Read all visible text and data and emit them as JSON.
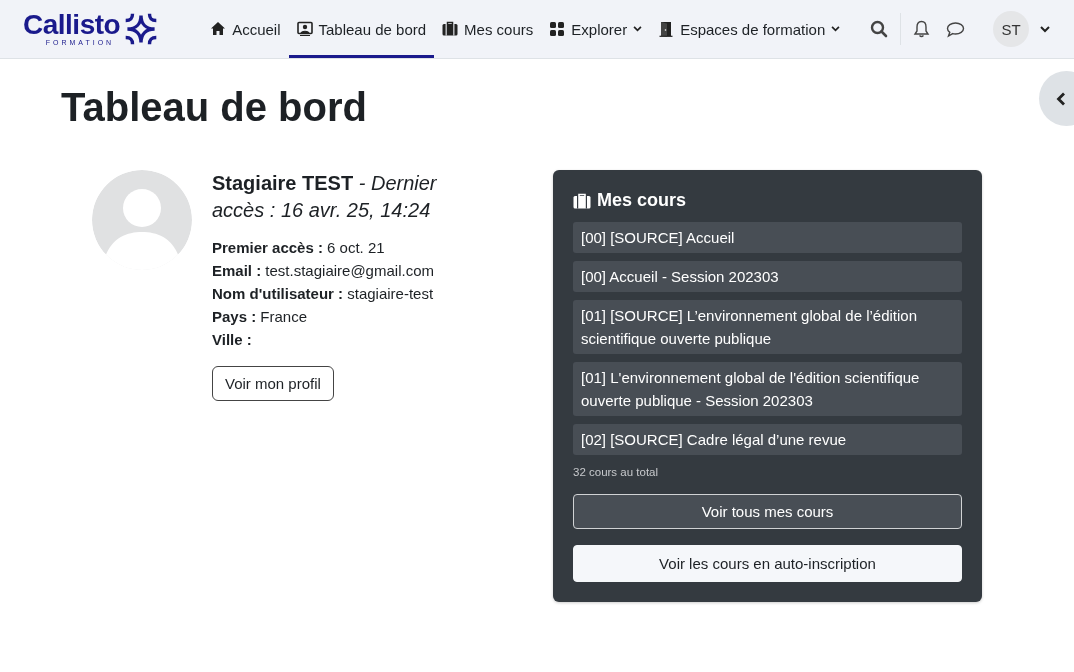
{
  "logo": {
    "name": "Callisto",
    "tagline": "FORMATION"
  },
  "nav": [
    {
      "label": "Accueil",
      "kind": "home",
      "selected": false,
      "dropdown": false
    },
    {
      "label": "Tableau de bord",
      "kind": "dashboard",
      "selected": true,
      "dropdown": false
    },
    {
      "label": "Mes cours",
      "kind": "briefcase",
      "selected": false,
      "dropdown": false
    },
    {
      "label": "Explorer",
      "kind": "grid",
      "selected": false,
      "dropdown": true
    },
    {
      "label": "Espaces de formation",
      "kind": "door",
      "selected": false,
      "dropdown": true
    }
  ],
  "user_menu": {
    "initials": "ST"
  },
  "page_title": "Tableau de bord",
  "profile": {
    "heading": "**Stagiaire TEST** *- Dernier accès : 16 avr. 25, 14:24*",
    "fields": [
      "**Premier accès :** 6 oct. 21",
      "**Email :** test.stagiaire@gmail.com",
      "**Nom d'utilisateur :** stagiaire-test",
      "**Pays :** France",
      "**Ville :**"
    ],
    "button": "Voir mon profil"
  },
  "courses_card": {
    "title": "Mes cours",
    "courses": [
      "[00] [SOURCE] Accueil",
      "[00] Accueil - Session 202303",
      "[01] [SOURCE] L’environnement global de l’édition scientifique ouverte publique",
      "[01] L'environnement global de l'édition scientifique ouverte publique - Session 202303",
      "[02] [SOURCE] Cadre légal d’une revue"
    ],
    "total": "32 cours au total",
    "buttons": [
      {
        "label": "Voir tous mes cours",
        "kind": "outline"
      },
      {
        "label": "Voir les cours en auto-inscription",
        "kind": "light"
      }
    ]
  }
}
